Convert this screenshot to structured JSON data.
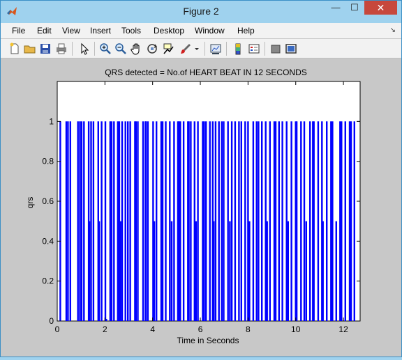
{
  "window": {
    "title": "Figure 2",
    "controls": {
      "minimize": "—",
      "maximize": "☐",
      "close": "✕"
    }
  },
  "menu": [
    "File",
    "Edit",
    "View",
    "Insert",
    "Tools",
    "Desktop",
    "Window",
    "Help"
  ],
  "toolbar": {
    "buttons": [
      "new-figure",
      "open-file",
      "save",
      "print",
      "edit-plot",
      "zoom-in",
      "zoom-out",
      "pan",
      "rotate-3d",
      "data-cursor",
      "brush",
      "link-plot",
      "colorbar",
      "legend",
      "hide-plot-tools",
      "show-plot-tools"
    ]
  },
  "colors": {
    "bar": "#0000ff",
    "figure_bg": "#c8c8c8",
    "titlebar": "#9fd2ee",
    "close": "#c7483c"
  },
  "chart_data": {
    "type": "bar",
    "title": "QRS detected = No.of HEART BEAT IN 12 SECONDS",
    "xlabel": "Time in Seconds",
    "ylabel": "qrs",
    "xlim": [
      0,
      12.7
    ],
    "ylim": [
      0,
      1.2
    ],
    "xticks": [
      "0",
      "2",
      "4",
      "6",
      "8",
      "10",
      "12"
    ],
    "yticks": [
      "0",
      "0.2",
      "0.4",
      "0.6",
      "0.8",
      "1"
    ],
    "grid": false,
    "series": [
      {
        "x": [
          0.13,
          0.38,
          0.45,
          0.55,
          0.87,
          0.95,
          1.02,
          1.12,
          1.32,
          1.35,
          1.42,
          1.52,
          1.72,
          1.76,
          1.86,
          2.02,
          2.06,
          2.22,
          2.28,
          2.38,
          2.54,
          2.6,
          2.65,
          2.72,
          2.86,
          2.96,
          3.06,
          3.26,
          3.3,
          3.38,
          3.6,
          3.7,
          3.72,
          3.8,
          4.02,
          4.07,
          4.16,
          4.36,
          4.42,
          4.55,
          4.72,
          4.8,
          4.9,
          5.06,
          5.1,
          5.16,
          5.3,
          5.48,
          5.52,
          5.6,
          5.76,
          5.82,
          5.9,
          6.1,
          6.16,
          6.24,
          6.4,
          6.52,
          6.56,
          6.64,
          6.78,
          6.9,
          6.98,
          7.16,
          7.24,
          7.32,
          7.46,
          7.62,
          7.72,
          7.88,
          8.0,
          8.06,
          8.22,
          8.36,
          8.44,
          8.58,
          8.74,
          8.8,
          8.92,
          9.1,
          9.16,
          9.3,
          9.44,
          9.62,
          9.68,
          9.82,
          10.0,
          10.04,
          10.22,
          10.36,
          10.44,
          10.6,
          10.72,
          10.76,
          10.94,
          11.1,
          11.14,
          11.3,
          11.48,
          11.54,
          11.7,
          11.86,
          11.92,
          12.08,
          12.26,
          12.32,
          12.46
        ],
        "values": [
          1,
          1,
          1,
          1,
          1,
          1,
          1,
          1,
          1,
          0.5,
          1,
          1,
          1,
          0.5,
          1,
          1,
          0.01,
          1,
          1,
          1,
          1,
          1,
          0.5,
          1,
          1,
          1,
          1,
          1,
          1,
          1,
          1,
          1,
          1,
          1,
          1,
          0.5,
          1,
          1,
          1,
          1,
          1,
          0.5,
          1,
          1,
          1,
          1,
          1,
          1,
          1,
          1,
          1,
          0.5,
          1,
          1,
          1,
          1,
          1,
          1,
          0.5,
          1,
          1,
          1,
          1,
          1,
          0.5,
          1,
          1,
          1,
          1,
          1,
          1,
          0.5,
          1,
          1,
          1,
          1,
          1,
          0.5,
          1,
          1,
          1,
          1,
          1,
          1,
          0.5,
          1,
          1,
          1,
          1,
          1,
          0.5,
          1,
          1,
          1,
          1,
          1,
          0.5,
          1,
          1,
          1,
          0.5,
          1,
          1,
          1,
          1,
          1,
          1
        ]
      }
    ]
  }
}
